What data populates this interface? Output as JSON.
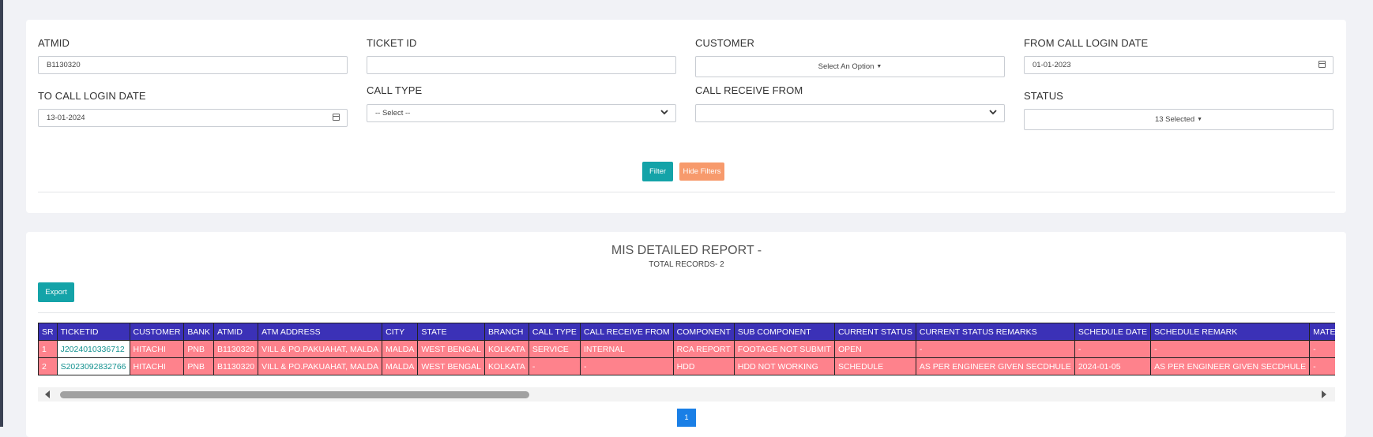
{
  "filters": {
    "atmid": {
      "label": "ATMID",
      "value": "B1130320"
    },
    "ticket_id": {
      "label": "TICKET ID",
      "value": ""
    },
    "customer": {
      "label": "CUSTOMER",
      "value": "Select An Option"
    },
    "from_date": {
      "label": "FROM CALL LOGIN DATE",
      "value": "01-01-2023"
    },
    "to_date": {
      "label": "TO CALL LOGIN DATE",
      "value": "13-01-2024"
    },
    "call_type": {
      "label": "CALL TYPE",
      "value": "-- Select --"
    },
    "call_receive_from": {
      "label": "CALL RECEIVE FROM",
      "value": ""
    },
    "status": {
      "label": "STATUS",
      "value": "13 Selected"
    },
    "filter_button": "Filter",
    "hide_filters_button": "Hide Filters"
  },
  "report": {
    "title": "MIS DETAILED REPORT -",
    "subtitle": "TOTAL RECORDS- 2",
    "export_button": "Export",
    "columns": [
      "SR",
      "TICKETID",
      "CUSTOMER",
      "BANK",
      "ATMID",
      "ATM ADDRESS",
      "CITY",
      "STATE",
      "BRANCH",
      "CALL TYPE",
      "CALL RECEIVE FROM",
      "COMPONENT",
      "SUB COMPONENT",
      "CURRENT STATUS",
      "CURRENT STATUS REMARKS",
      "SCHEDULE DATE",
      "SCHEDULE REMARK",
      "MATERIAL CONDITION"
    ],
    "rows": [
      [
        "1",
        "J2024010336712",
        "HITACHI",
        "PNB",
        "B1130320",
        "VILL & PO.PAKUAHAT, MALDA",
        "MALDA",
        "WEST BENGAL",
        "KOLKATA",
        "SERVICE",
        "INTERNAL",
        "RCA REPORT",
        "FOOTAGE NOT SUBMIT",
        "OPEN",
        "-",
        "-",
        "-",
        "-"
      ],
      [
        "2",
        "S2023092832766",
        "HITACHI",
        "PNB",
        "B1130320",
        "VILL & PO.PAKUAHAT, MALDA",
        "MALDA",
        "WEST BENGAL",
        "KOLKATA",
        "-",
        "-",
        "HDD",
        "HDD NOT WORKING",
        "SCHEDULE",
        "AS PER ENGINEER GIVEN SECDHULE",
        "2024-01-05",
        "AS PER ENGINEER GIVEN SECDHULE",
        "-"
      ]
    ]
  },
  "pagination": {
    "current_page": "1"
  },
  "colors": {
    "header": "#3b31b7",
    "row": "#fe828c",
    "teal": "#14a3a8",
    "orange": "#f79a6c"
  }
}
